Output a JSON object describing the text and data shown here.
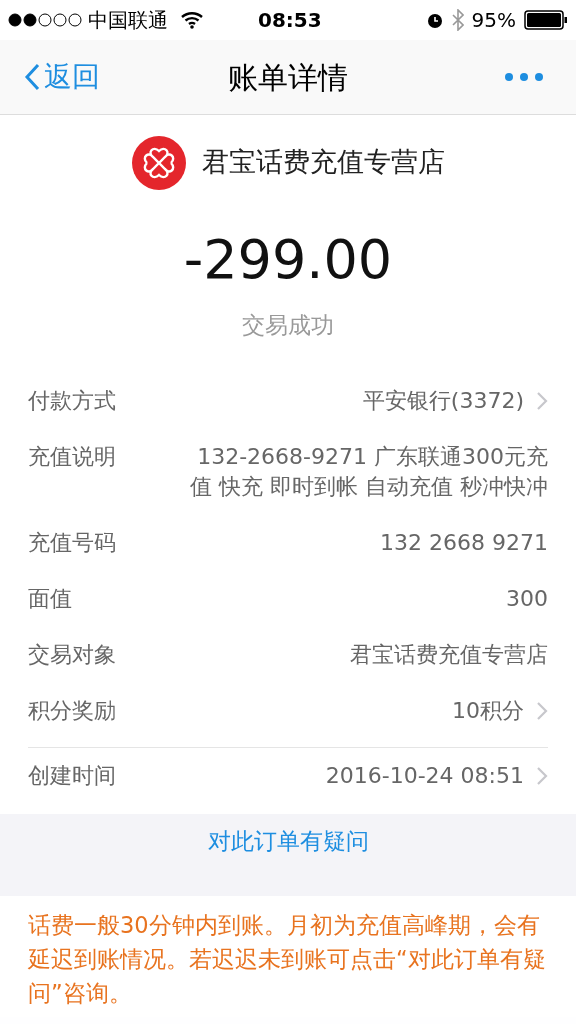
{
  "status_bar": {
    "carrier": "中国联通",
    "time": "08:53",
    "battery": "95%"
  },
  "nav": {
    "back": "返回",
    "title": "账单详情"
  },
  "merchant": {
    "name": "君宝话费充值专营店"
  },
  "amount": "-299.00",
  "status": "交易成功",
  "details": [
    {
      "label": "付款方式",
      "value": "平安银行(3372)",
      "chevron": true
    },
    {
      "label": "充值说明",
      "value": "132-2668-9271 广东联通300元充值 快充 即时到帐 自动充值 秒冲快冲",
      "chevron": false
    },
    {
      "label": "充值号码",
      "value": "132 2668 9271",
      "chevron": false
    },
    {
      "label": "面值",
      "value": "300",
      "chevron": false
    },
    {
      "label": "交易对象",
      "value": "君宝话费充值专营店",
      "chevron": false
    },
    {
      "label": "积分奖励",
      "value": "10积分",
      "chevron": true
    }
  ],
  "created": {
    "label": "创建时间",
    "value": "2016-10-24 08:51",
    "chevron": true
  },
  "question_link": "对此订单有疑问",
  "toast": "话费一般30分钟内到账。月初为充值高峰期，会有延迟到账情况。若迟迟未到账可点击“对此订单有疑问”咨询。"
}
